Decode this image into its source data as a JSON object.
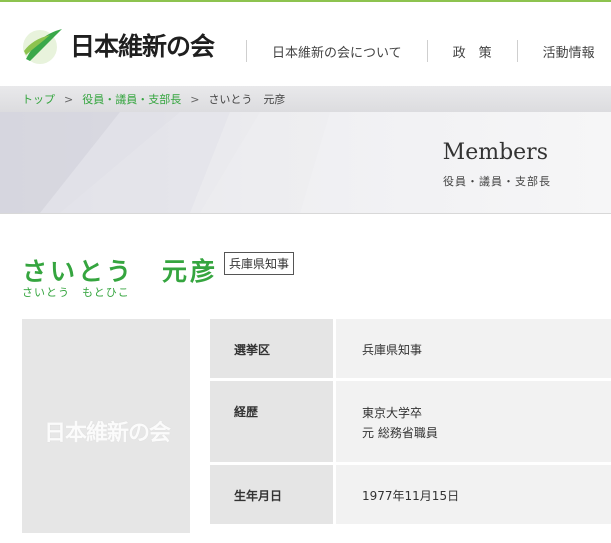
{
  "header": {
    "logo_text": "日本維新の会",
    "nav": [
      "日本維新の会について",
      "政　策",
      "活動情報"
    ]
  },
  "breadcrumb": {
    "items": [
      "トップ",
      "役員・議員・支部長"
    ],
    "separator": ">",
    "current": "さいとう　元彦"
  },
  "hero": {
    "title": "Members",
    "subtitle": "役員・議員・支部長"
  },
  "profile": {
    "name": "さいとう　元彦",
    "kana": "さいとう　もとひこ",
    "post": "兵庫県知事",
    "photo_watermark": "日本維新の会"
  },
  "info": {
    "rows": [
      {
        "label": "選挙区",
        "lines": [
          "兵庫県知事"
        ]
      },
      {
        "label": "経歴",
        "lines": [
          "東京大学卒",
          "元 総務省職員"
        ]
      },
      {
        "label": "生年月日",
        "lines": [
          "1977年11月15日"
        ]
      }
    ]
  },
  "colors": {
    "accent": "#35a53f",
    "top_line": "#8dc34f",
    "label_bg": "#e5e5e5",
    "value_bg": "#f2f2f2"
  }
}
